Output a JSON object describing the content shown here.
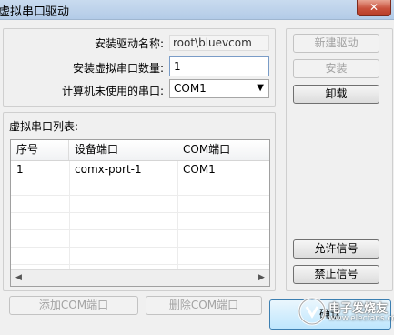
{
  "window": {
    "title": "虚拟串口驱动",
    "close_symbol": "✕"
  },
  "install": {
    "driver_name_label": "安装驱动名称:",
    "driver_name_value": "root\\bluevcom",
    "port_count_label": "安装虚拟串口数量:",
    "port_count_value": "1",
    "unused_port_label": "计算机未使用的串口:",
    "unused_port_value": "COM1",
    "dropdown_arrow": "▼"
  },
  "port_list": {
    "title": "虚拟串口列表:",
    "columns": [
      "序号",
      "设备端口",
      "COM端口"
    ],
    "rows": [
      [
        "1",
        "comx-port-1",
        "COM1"
      ]
    ],
    "scroll_left": "◀",
    "scroll_right": "▶"
  },
  "buttons": {
    "new_driver": "新建驱动",
    "install": "安装",
    "uninstall": "卸载",
    "allow_signal": "允许信号",
    "block_signal": "禁止信号",
    "add_com": "添加COM端口",
    "delete_com": "删除COM端口",
    "ok": "确认"
  },
  "watermark": {
    "text": "电子发烧友",
    "sub": "www.elecfans.com"
  }
}
